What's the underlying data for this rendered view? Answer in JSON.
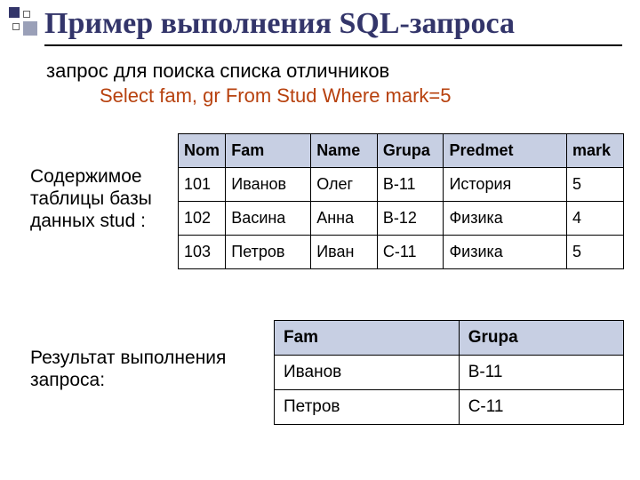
{
  "title": "Пример выполнения SQL-запроса",
  "subtitle": "запрос для поиска списка отличников",
  "sql_line": "Select fam, gr  From Stud  Where mark=5",
  "caption_table": "Содержимое таблицы базы данных stud :",
  "caption_result": "Результат выполнения запроса:",
  "table1": {
    "headers": {
      "nom": "Nom",
      "fam": "Fam",
      "name": "Name",
      "grupa": "Grupa",
      "predmet": "Predmet",
      "mark": "mark"
    },
    "rows": [
      {
        "nom": "101",
        "fam": "Иванов",
        "name": "Олег",
        "grupa": "В-11",
        "predmet": "История",
        "mark": "5"
      },
      {
        "nom": "102",
        "fam": "Васина",
        "name": "Анна",
        "grupa": "В-12",
        "predmet": "Физика",
        "mark": "4"
      },
      {
        "nom": "103",
        "fam": "Петров",
        "name": "Иван",
        "grupa": "С-11",
        "predmet": "Физика",
        "mark": "5"
      }
    ]
  },
  "table2": {
    "headers": {
      "fam": "Fam",
      "grupa": "Grupa"
    },
    "rows": [
      {
        "fam": "Иванов",
        "grupa": "В-11"
      },
      {
        "fam": "Петров",
        "grupa": "С-11"
      }
    ]
  }
}
